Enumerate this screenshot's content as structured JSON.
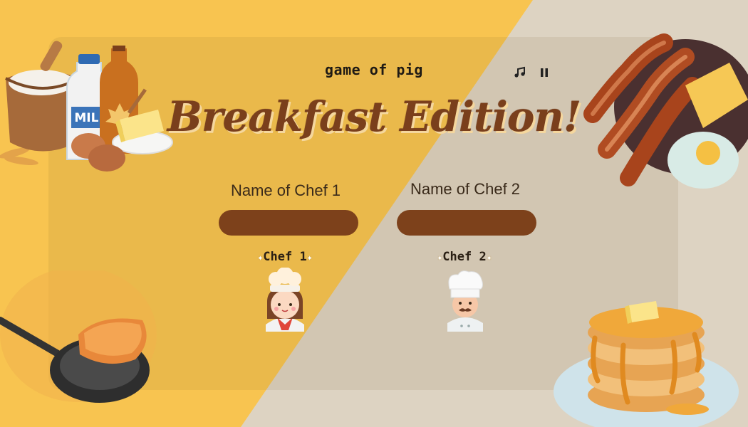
{
  "header": {
    "game_title": "game of pig",
    "headline": "Breakfast Edition!"
  },
  "controls": {
    "music_icon": "music-note-icon",
    "pause_icon": "pause-icon"
  },
  "players": [
    {
      "label": "Name of Chef 1",
      "input_value": "",
      "chef_tag": "Chef 1",
      "avatar": "girl-chef"
    },
    {
      "label": "Name of Chef 2",
      "input_value": "",
      "chef_tag": "Chef 2",
      "avatar": "mustache-chef"
    }
  ],
  "decorations": {
    "milk_label": "MILK"
  },
  "colors": {
    "bg_yellow": "#f8c450",
    "bg_beige": "#ddd3c2",
    "input_brown": "#7d411b",
    "headline_brown": "#7a3f1c"
  }
}
